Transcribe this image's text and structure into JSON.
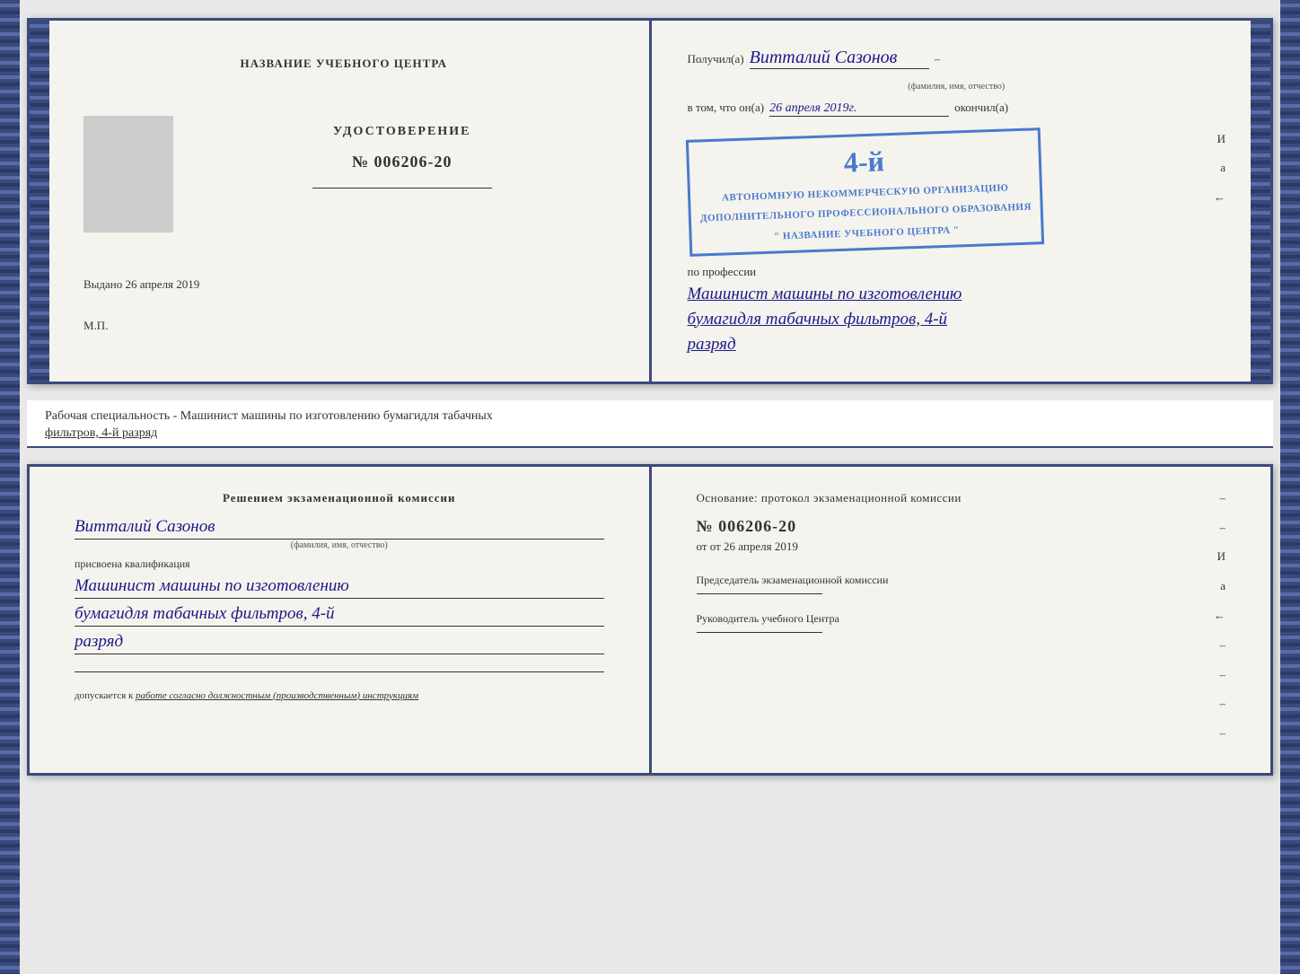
{
  "top_booklet": {
    "left": {
      "center_title": "НАЗВАНИЕ УЧЕБНОГО ЦЕНТРА",
      "udostoverenie": "УДОСТОВЕРЕНИЕ",
      "number": "№ 006206-20",
      "vydano": "Выдано 26 апреля 2019",
      "mp": "М.П."
    },
    "right": {
      "poluchil_prefix": "Получил(a)",
      "recipient_name": "Витталий Сазонов",
      "name_sub": "(фамилия, имя, отчество)",
      "v_tom_chto": "в том, что он(а)",
      "date_handwritten": "26 апреля 2019г.",
      "okonchil": "окончил(а)",
      "stamp_number": "4-й",
      "stamp_line1": "АВТОНОМНУЮ НЕКОММЕРЧЕСКУЮ ОРГАНИЗАЦИЮ",
      "stamp_line2": "ДОПОЛНИТЕЛЬНОГО ПРОФЕССИОНАЛЬНОГО ОБРАЗОВАНИЯ",
      "stamp_line3": "\" НАЗВАНИЕ УЧЕБНОГО ЦЕНТРА \"",
      "i_label": "И",
      "a_label": "а",
      "arrow_label": "←",
      "po_professii": "по профессии",
      "profession_line1": "Машинист машины по изготовлению",
      "profession_line2": "бумагидля табачных фильтров, 4-й",
      "profession_line3": "разряд"
    }
  },
  "description": {
    "text": "Рабочая специальность - Машинист машины по изготовлению бумагидля табачных",
    "text2": "фильтров, 4-й разряд"
  },
  "bottom_booklet": {
    "left": {
      "resheniem": "Решением  экзаменационной  комиссии",
      "name_handwritten": "Витталий Сазонов",
      "name_sub": "(фамилия, имя, отчество)",
      "prisvoena": "присвоена квалификация",
      "qual_line1": "Машинист машины по изготовлению",
      "qual_line2": "бумагидля табачных фильтров, 4-й",
      "qual_line3": "разряд",
      "dopuskaetsya_prefix": "допускается к",
      "dopuskaetsya_text": "работе согласно должностным (производственным) инструкциям"
    },
    "right": {
      "osnovanie": "Основание: протокол экзаменационной  комиссии",
      "number_label": "№ 006206-20",
      "ot_label": "от 26 апреля 2019",
      "dash1": "–",
      "dash2": "–",
      "i_label": "И",
      "a_label": "а",
      "arrow_label": "←",
      "predsedatel_label": "Председатель экзаменационной комиссии",
      "rukovoditel_label": "Руководитель учебного Центра"
    }
  }
}
